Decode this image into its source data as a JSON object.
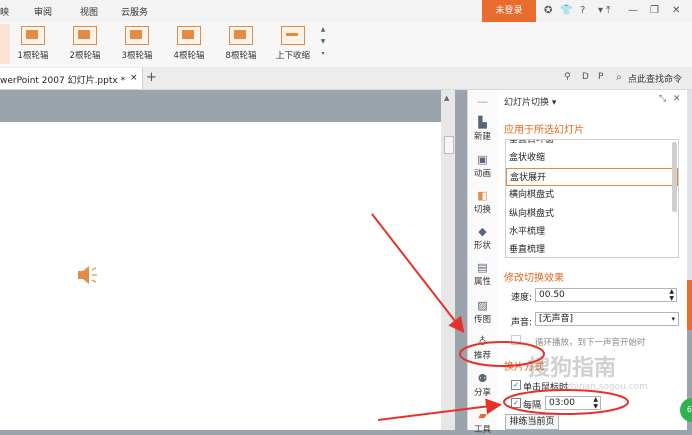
{
  "menu": {
    "items": [
      "映",
      "审阅",
      "视图",
      "云服务"
    ],
    "login": "未登录"
  },
  "ribbon": {
    "buttons": [
      {
        "label": "1根轮辐"
      },
      {
        "label": "2根轮辐"
      },
      {
        "label": "3根轮辐"
      },
      {
        "label": "4根轮辐"
      },
      {
        "label": "8根轮辐"
      },
      {
        "label": "上下收缩"
      }
    ]
  },
  "tabs": {
    "doc_title": "werPoint 2007 幻灯片.pptx *",
    "close": "×",
    "new_tab": "+",
    "search": "点此查找命令"
  },
  "sidebar": {
    "items": [
      {
        "icon": "new-icon",
        "label": "新建"
      },
      {
        "icon": "animation-icon",
        "label": "动画"
      },
      {
        "icon": "transition-icon",
        "label": "切换"
      },
      {
        "icon": "shape-icon",
        "label": "形状"
      },
      {
        "icon": "property-icon",
        "label": "属性"
      },
      {
        "icon": "image-icon",
        "label": "传图"
      },
      {
        "icon": "recommend-icon",
        "label": "推荐"
      },
      {
        "icon": "share-icon",
        "label": "分享"
      },
      {
        "icon": "tools-icon",
        "label": "工具"
      }
    ]
  },
  "pane": {
    "title": "幻灯片切换 ▾",
    "section_apply": "应用于所选幻灯片",
    "effects": [
      "垂直百叶窗",
      "盒状收缩",
      "盒状展开",
      "横向棋盘式",
      "纵向棋盘式",
      "水平梳理",
      "垂直梳理"
    ],
    "selected_effect": "盒状展开",
    "section_modify": "修改切换效果",
    "speed_label": "速度:",
    "speed_value": "00.50",
    "sound_label": "声音:",
    "sound_value": "[无声音]",
    "loop_label": "循环播放，到下一声音开始时",
    "section_advance": "换片方式",
    "on_click_label": "单击鼠标时",
    "every_label": "每隔",
    "every_value": "03:00",
    "apply_current": "排练当前页"
  },
  "watermark": {
    "text": "搜狗指南",
    "sub": "zhinan.sogou.com"
  },
  "badge": {
    "text": "65"
  },
  "colors": {
    "accent": "#e96b2e",
    "section": "#e0691f",
    "arrow": "#e8312a"
  }
}
